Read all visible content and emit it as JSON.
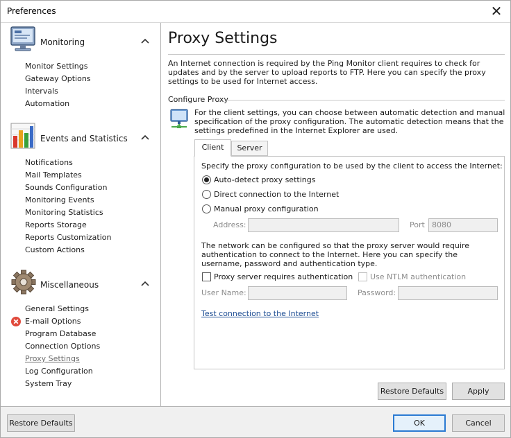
{
  "window": {
    "title": "Preferences",
    "close_glyph": "✕"
  },
  "sidebar": {
    "groups": [
      {
        "title": "Monitoring",
        "icon": "monitor-icon",
        "items": [
          "Monitor Settings",
          "Gateway Options",
          "Intervals",
          "Automation"
        ]
      },
      {
        "title": "Events and Statistics",
        "icon": "bar-chart-icon",
        "items": [
          "Notifications",
          "Mail Templates",
          "Sounds Configuration",
          "Monitoring Events",
          "Monitoring Statistics",
          "Reports Storage",
          "Reports Customization",
          "Custom Actions"
        ]
      },
      {
        "title": "Miscellaneous",
        "icon": "gear-icon",
        "items": [
          "General Settings",
          "E-mail Options",
          "Program Database",
          "Connection Options",
          "Proxy Settings",
          "Log Configuration",
          "System Tray"
        ]
      }
    ],
    "active_item": "Proxy Settings",
    "error_item": "E-mail Options"
  },
  "main": {
    "title": "Proxy Settings",
    "intro": "An Internet connection is required by the Ping Monitor client requires to check for updates and by the server to upload reports to FTP. Here you can specify the proxy settings to be used for Internet access.",
    "section_label": "Configure Proxy",
    "client_desc": "For the client settings, you can choose between automatic detection and manual specification of the proxy configuration. The automatic detection means that the settings predefined in the Internet Explorer are used.",
    "tabs": [
      {
        "label": "Client",
        "selected": true
      },
      {
        "label": "Server",
        "selected": false
      }
    ],
    "panel": {
      "heading": "Specify the proxy configuration to be used by the client to access the Internet:",
      "radios": [
        {
          "label": "Auto-detect proxy settings",
          "checked": true
        },
        {
          "label": "Direct connection to the Internet",
          "checked": false
        },
        {
          "label": "Manual proxy configuration",
          "checked": false
        }
      ],
      "address_label": "Address:",
      "address_value": "",
      "port_label": "Port",
      "port_value": "8080",
      "auth_desc": "The network can be configured so that the proxy server would require authentication to connect to the Internet. Here you can specify the username, password and authentication type.",
      "auth_checkbox": "Proxy server requires authentication",
      "ntlm_checkbox": "Use NTLM authentication",
      "username_label": "User Name:",
      "username_value": "",
      "password_label": "Password:",
      "password_value": "",
      "test_link": "Test connection to the Internet"
    },
    "buttons": {
      "restore": "Restore Defaults",
      "apply": "Apply"
    }
  },
  "footer": {
    "restore": "Restore Defaults",
    "ok": "OK",
    "cancel": "Cancel"
  },
  "colors": {
    "link": "#1e4e94",
    "error": "#e0493b",
    "default_button_border": "#2a7ad2"
  }
}
